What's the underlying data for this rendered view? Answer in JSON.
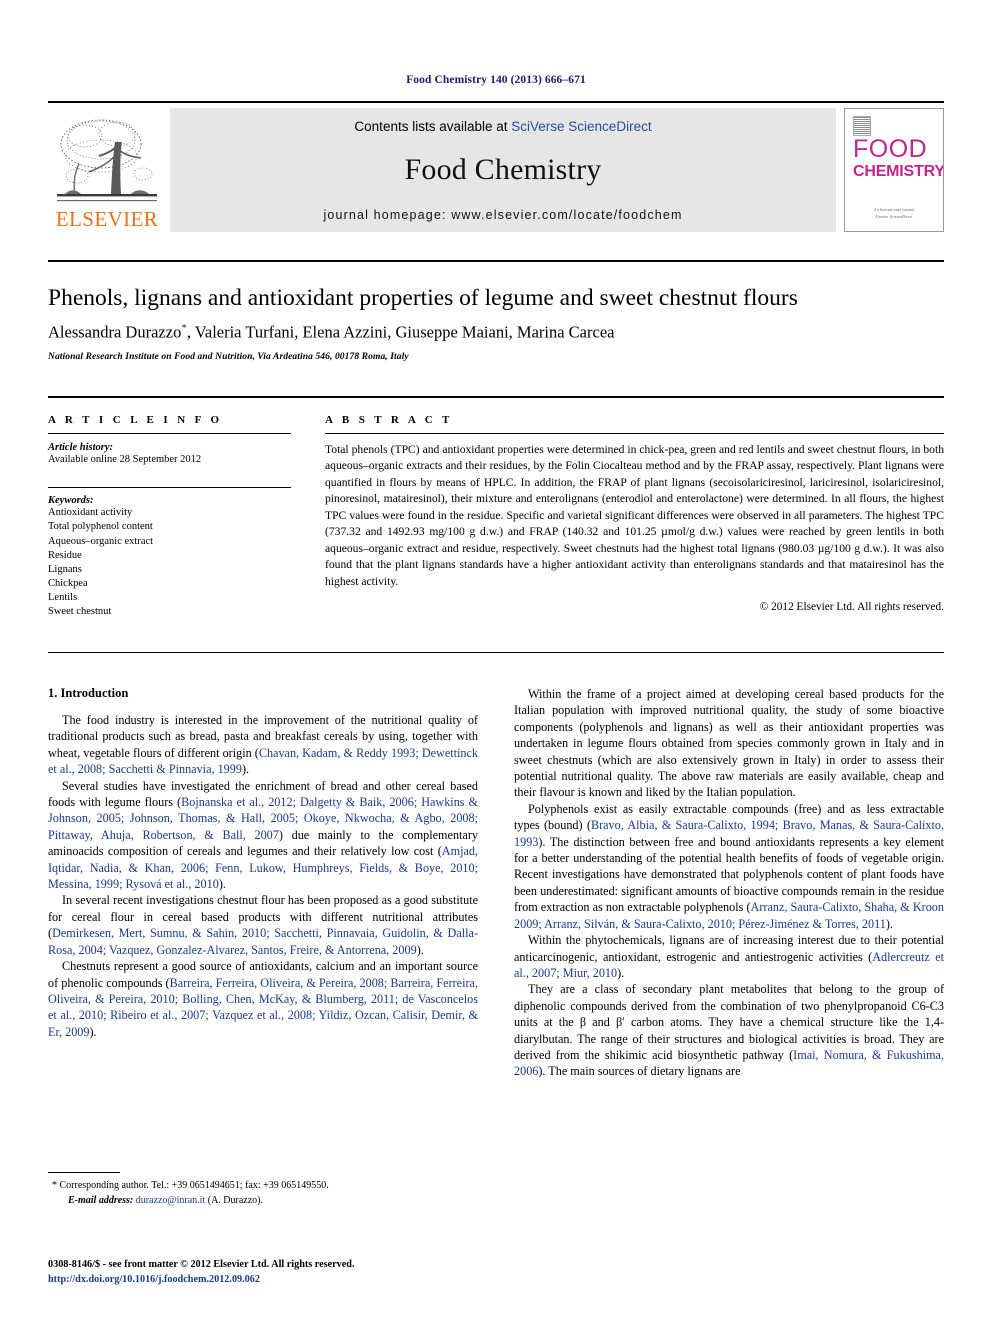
{
  "running_head": "Food Chemistry 140 (2013) 666–671",
  "masthead": {
    "contents_prefix": "Contents lists available at ",
    "sciencedirect_link": "SciVerse ScienceDirect",
    "journal_title": "Food Chemistry",
    "homepage": "journal homepage: www.elsevier.com/locate/foodchem",
    "publisher_wordmark": "ELSEVIER",
    "cover": {
      "line1": "FOOD",
      "line2": "CHEMISTRY",
      "footer_line1": "An International Journal",
      "footer_line2": "Elsevier ScienceDirect"
    }
  },
  "title": "Phenols, lignans and antioxidant properties of legume and sweet chestnut flours",
  "authors": "Alessandra Durazzo, Valeria Turfani, Elena Azzini, Giuseppe Maiani, Marina Carcea",
  "author_parts": {
    "a1": "Alessandra Durazzo",
    "star": "*",
    "rest": ", Valeria Turfani, Elena Azzini, Giuseppe Maiani, Marina Carcea"
  },
  "affiliation": "National Research Institute on Food and Nutrition, Via Ardeatina 546, 00178 Roma, Italy",
  "article_info": {
    "heading": "A R T I C L E   I N F O",
    "history_label": "Article history:",
    "history_value": "Available online 28 September 2012",
    "keywords_label": "Keywords:",
    "keywords": [
      "Antioxidant activity",
      "Total polyphenol content",
      "Aqueous–organic extract",
      "Residue",
      "Lignans",
      "Chickpea",
      "Lentils",
      "Sweet chestnut"
    ]
  },
  "abstract": {
    "heading": "A B S T R A C T",
    "body": "Total phenols (TPC) and antioxidant properties were determined in chick-pea, green and red lentils and sweet chestnut flours, in both aqueous–organic extracts and their residues, by the Folin Ciocalteau method and by the FRAP assay, respectively. Plant lignans were quantified in flours by means of HPLC. In addition, the FRAP of plant lignans (secoisolariciresinol, lariciresinol, isolariciresinol, pinoresinol, matairesinol), their mixture and enterolignans (enterodiol and enterolactone) were determined. In all flours, the highest TPC values were found in the residue. Specific and varietal significant differences were observed in all parameters. The highest TPC (737.32 and 1492.93 mg/100 g d.w.) and FRAP (140.32 and 101.25 µmol/g d.w.) values were reached by green lentils in both aqueous–organic extract and residue, respectively. Sweet chestnuts had the highest total lignans (980.03 µg/100 g d.w.). It was also found that the plant lignans standards have a higher antioxidant activity than enterolignans standards and that matairesinol has the highest activity.",
    "copyright": "© 2012 Elsevier Ltd. All rights reserved."
  },
  "body": {
    "section_heading": "1. Introduction",
    "left_paragraphs": [
      "The food industry is interested in the improvement of the nutritional quality of traditional products such as bread, pasta and breakfast cereals by using, together with wheat, vegetable flours of different origin (Chavan, Kadam, & Reddy 1993; Dewettinck et al., 2008; Sacchetti & Pinnavia, 1999).",
      "Several studies have investigated the enrichment of bread and other cereal based foods with legume flours (Bojnanska et al., 2012; Dalgetty & Baik, 2006; Hawkins & Johnson, 2005; Johnson, Thomas, & Hall, 2005; Okoye, Nkwocha, & Agbo, 2008; Pittaway, Ahuja, Robertson, & Ball, 2007) due mainly to the complementary aminoacids composition of cereals and legumes and their relatively low cost (Amjad, Iqtidar, Nadia, & Khan, 2006; Fenn, Lukow, Humphreys, Fields, & Boye, 2010; Messina, 1999; Rysová et al., 2010).",
      "In several recent investigations chestnut flour has been proposed as a good substitute for cereal flour in cereal based products with different nutritional attributes (Demirkesen, Mert, Sumnu, & Sahin, 2010; Sacchetti, Pinnavaia, Guidolin, & Dalla-Rosa, 2004; Vazquez, Gonzalez-Alvarez, Santos, Freire, & Antorrena, 2009).",
      "Chestnuts represent a good source of antioxidants, calcium and an important source of phenolic compounds (Barreira, Ferreira, Oliveira, & Pereira, 2008; Barreira, Ferreira, Oliveira, & Pereira, 2010; Bolling, Chen, McKay, & Blumberg, 2011; de Vasconcelos et al., 2010; Ribeiro et al., 2007; Vazquez et al., 2008; Yildiz, Ozcan, Calisir, Demir, & Er, 2009)."
    ],
    "right_paragraphs": [
      "Within the frame of a project aimed at developing cereal based products for the Italian population with improved nutritional quality, the study of some bioactive components (polyphenols and lignans) as well as their antioxidant properties was undertaken in legume flours obtained from species commonly grown in Italy and in sweet chestnuts (which are also extensively grown in Italy) in order to assess their potential nutritional quality. The above raw materials are easily available, cheap and their flavour is known and liked by the Italian population.",
      "Polyphenols exist as easily extractable compounds (free) and as less extractable types (bound) (Bravo, Albia, & Saura-Calixto, 1994; Bravo, Manas, & Saura-Calixto, 1993). The distinction between free and bound antioxidants represents a key element for a better understanding of the potential health benefits of foods of vegetable origin. Recent investigations have demonstrated that polyphenols content of plant foods have been underestimated: significant amounts of bioactive compounds remain in the residue from extraction as non extractable polyphenols (Arranz, Saura-Calixto, Shaha, & Kroon 2009; Arranz, Silván, & Saura-Calixto, 2010; Pérez-Jiménez & Torres, 2011).",
      "Within the phytochemicals, lignans are of increasing interest due to their potential anticarcinogenic, antioxidant, estrogenic and antiestrogenic activities (Adlercreutz et al., 2007; Miur, 2010).",
      "They are a class of secondary plant metabolites that belong to the group of diphenolic compounds derived from the combination of two phenylpropanoid C6-C3 units at the β and β′ carbon atoms. They have a chemical structure like the 1,4-diarylbutan. The range of their structures and biological activities is broad. They are derived from the shikimic acid biosynthetic pathway (Imai, Nomura, & Fukushima, 2006). The main sources of dietary lignans are"
    ]
  },
  "footnote": {
    "star": "*",
    "corresponding": "Corresponding author. Tel.: +39 0651494651; fax: +39 065149550.",
    "email_label": "E-mail address:",
    "email": "durazzo@inran.it",
    "email_owner": "(A. Durazzo)."
  },
  "footer": {
    "issn_line": "0308-8146/$ - see front matter © 2012 Elsevier Ltd. All rights reserved.",
    "doi": "http://dx.doi.org/10.1016/j.foodchem.2012.09.062"
  },
  "colors": {
    "link_blue": "#1b3a8c",
    "header_blue": "#1b1b6f",
    "elsevier_orange": "#E9711C",
    "cover_magenta": "#C2268C",
    "banner_gray": "#e6e6e6"
  }
}
